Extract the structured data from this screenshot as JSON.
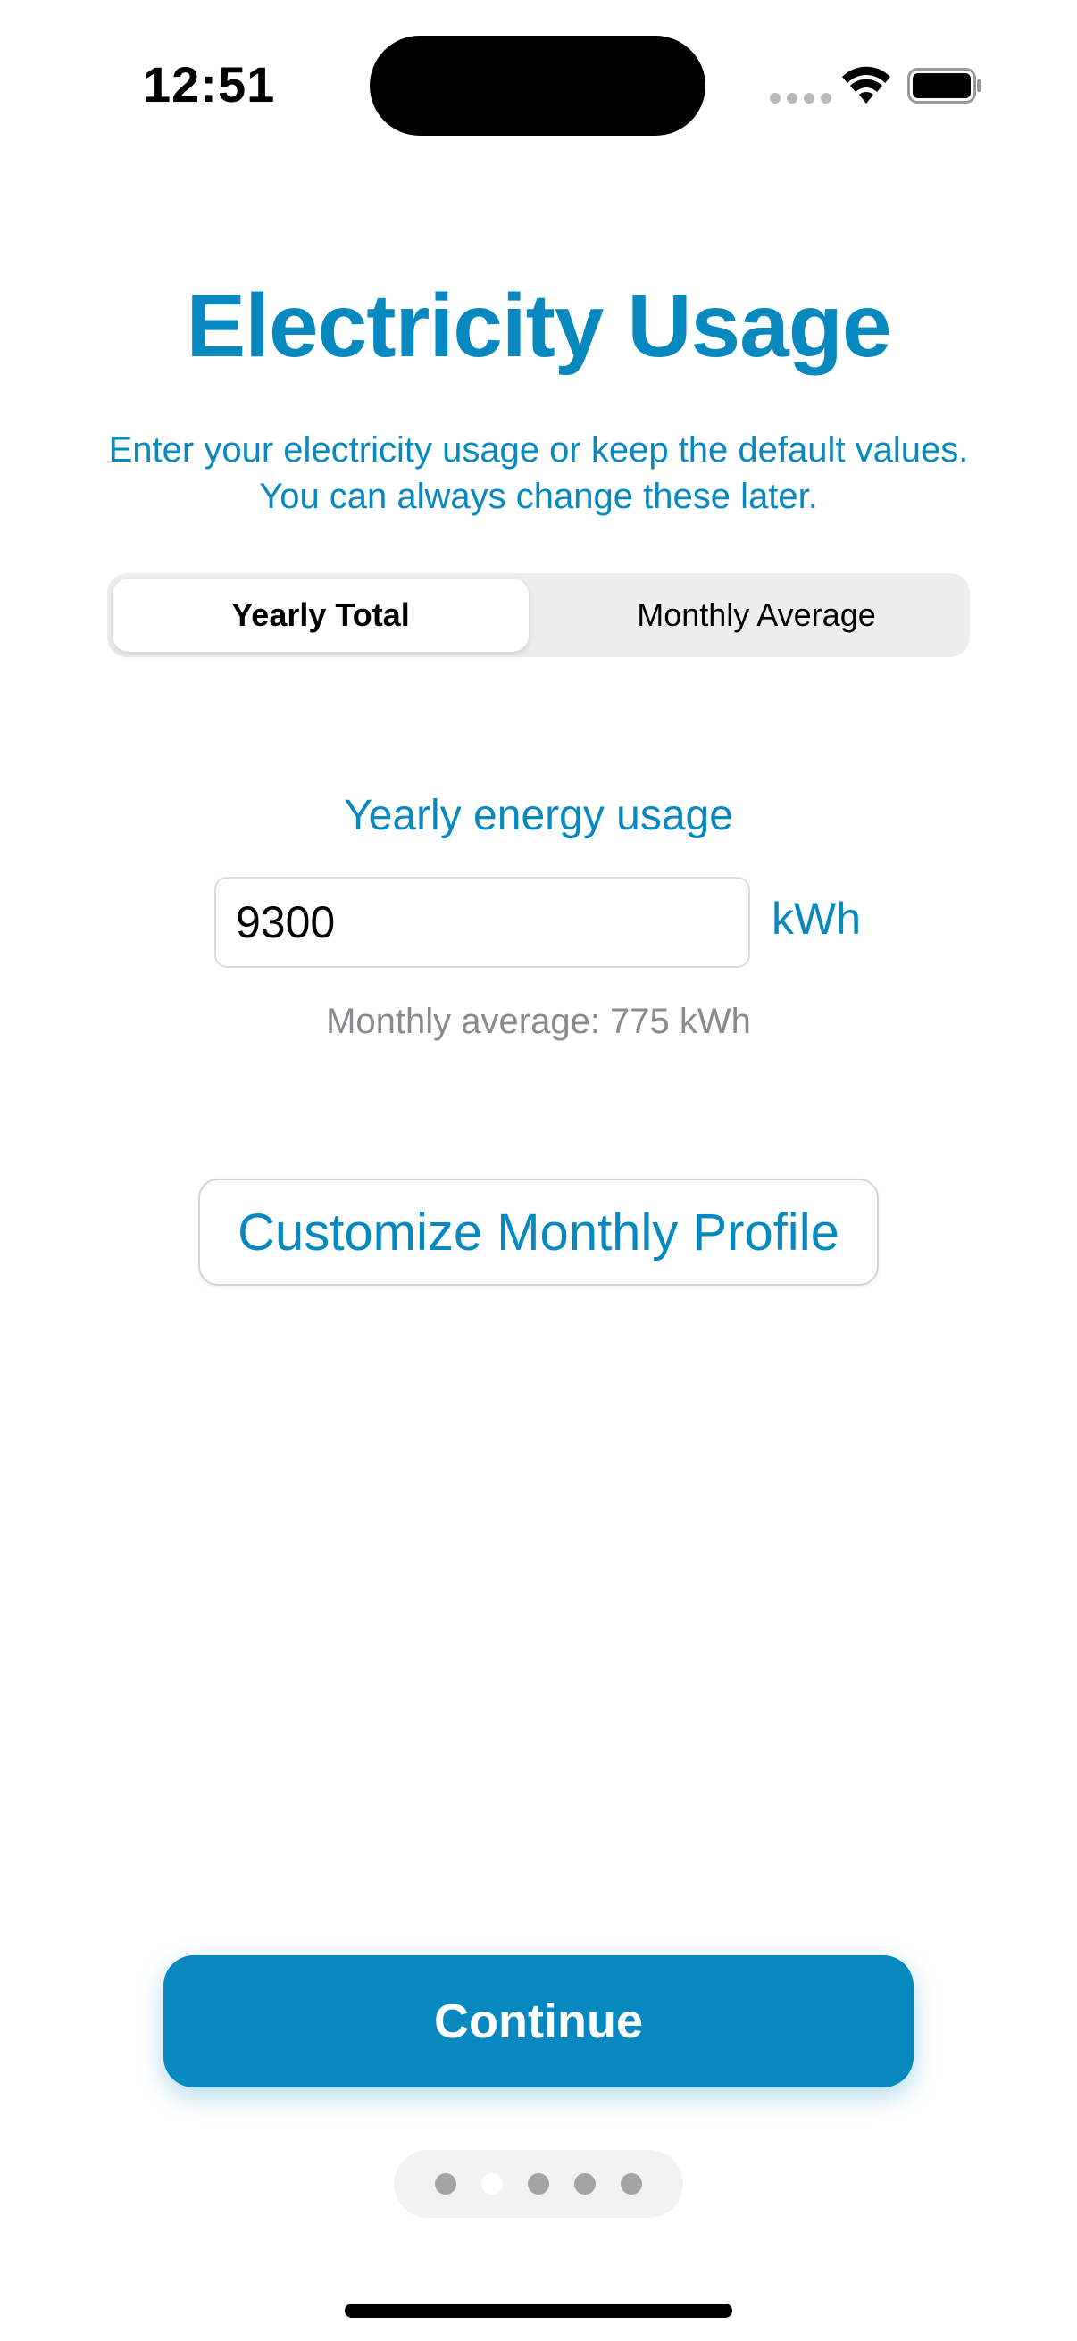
{
  "status_bar": {
    "time": "12:51"
  },
  "page": {
    "title": "Electricity Usage",
    "subtitle": "Enter your electricity usage or keep the default values. You can always change these later."
  },
  "segmented_control": {
    "options": [
      "Yearly Total",
      "Monthly Average"
    ],
    "selected": "Yearly Total"
  },
  "usage": {
    "label": "Yearly energy usage",
    "value": "9300",
    "unit": "kWh",
    "monthly_average_text": "Monthly average: 775 kWh"
  },
  "buttons": {
    "customize_label": "Customize Monthly Profile",
    "continue_label": "Continue"
  },
  "pager": {
    "total_pages": 5,
    "current_page": 2
  },
  "colors": {
    "accent": "#0789c0",
    "secondary_text": "#8a8a8e",
    "segment_background": "#eeeeef"
  }
}
